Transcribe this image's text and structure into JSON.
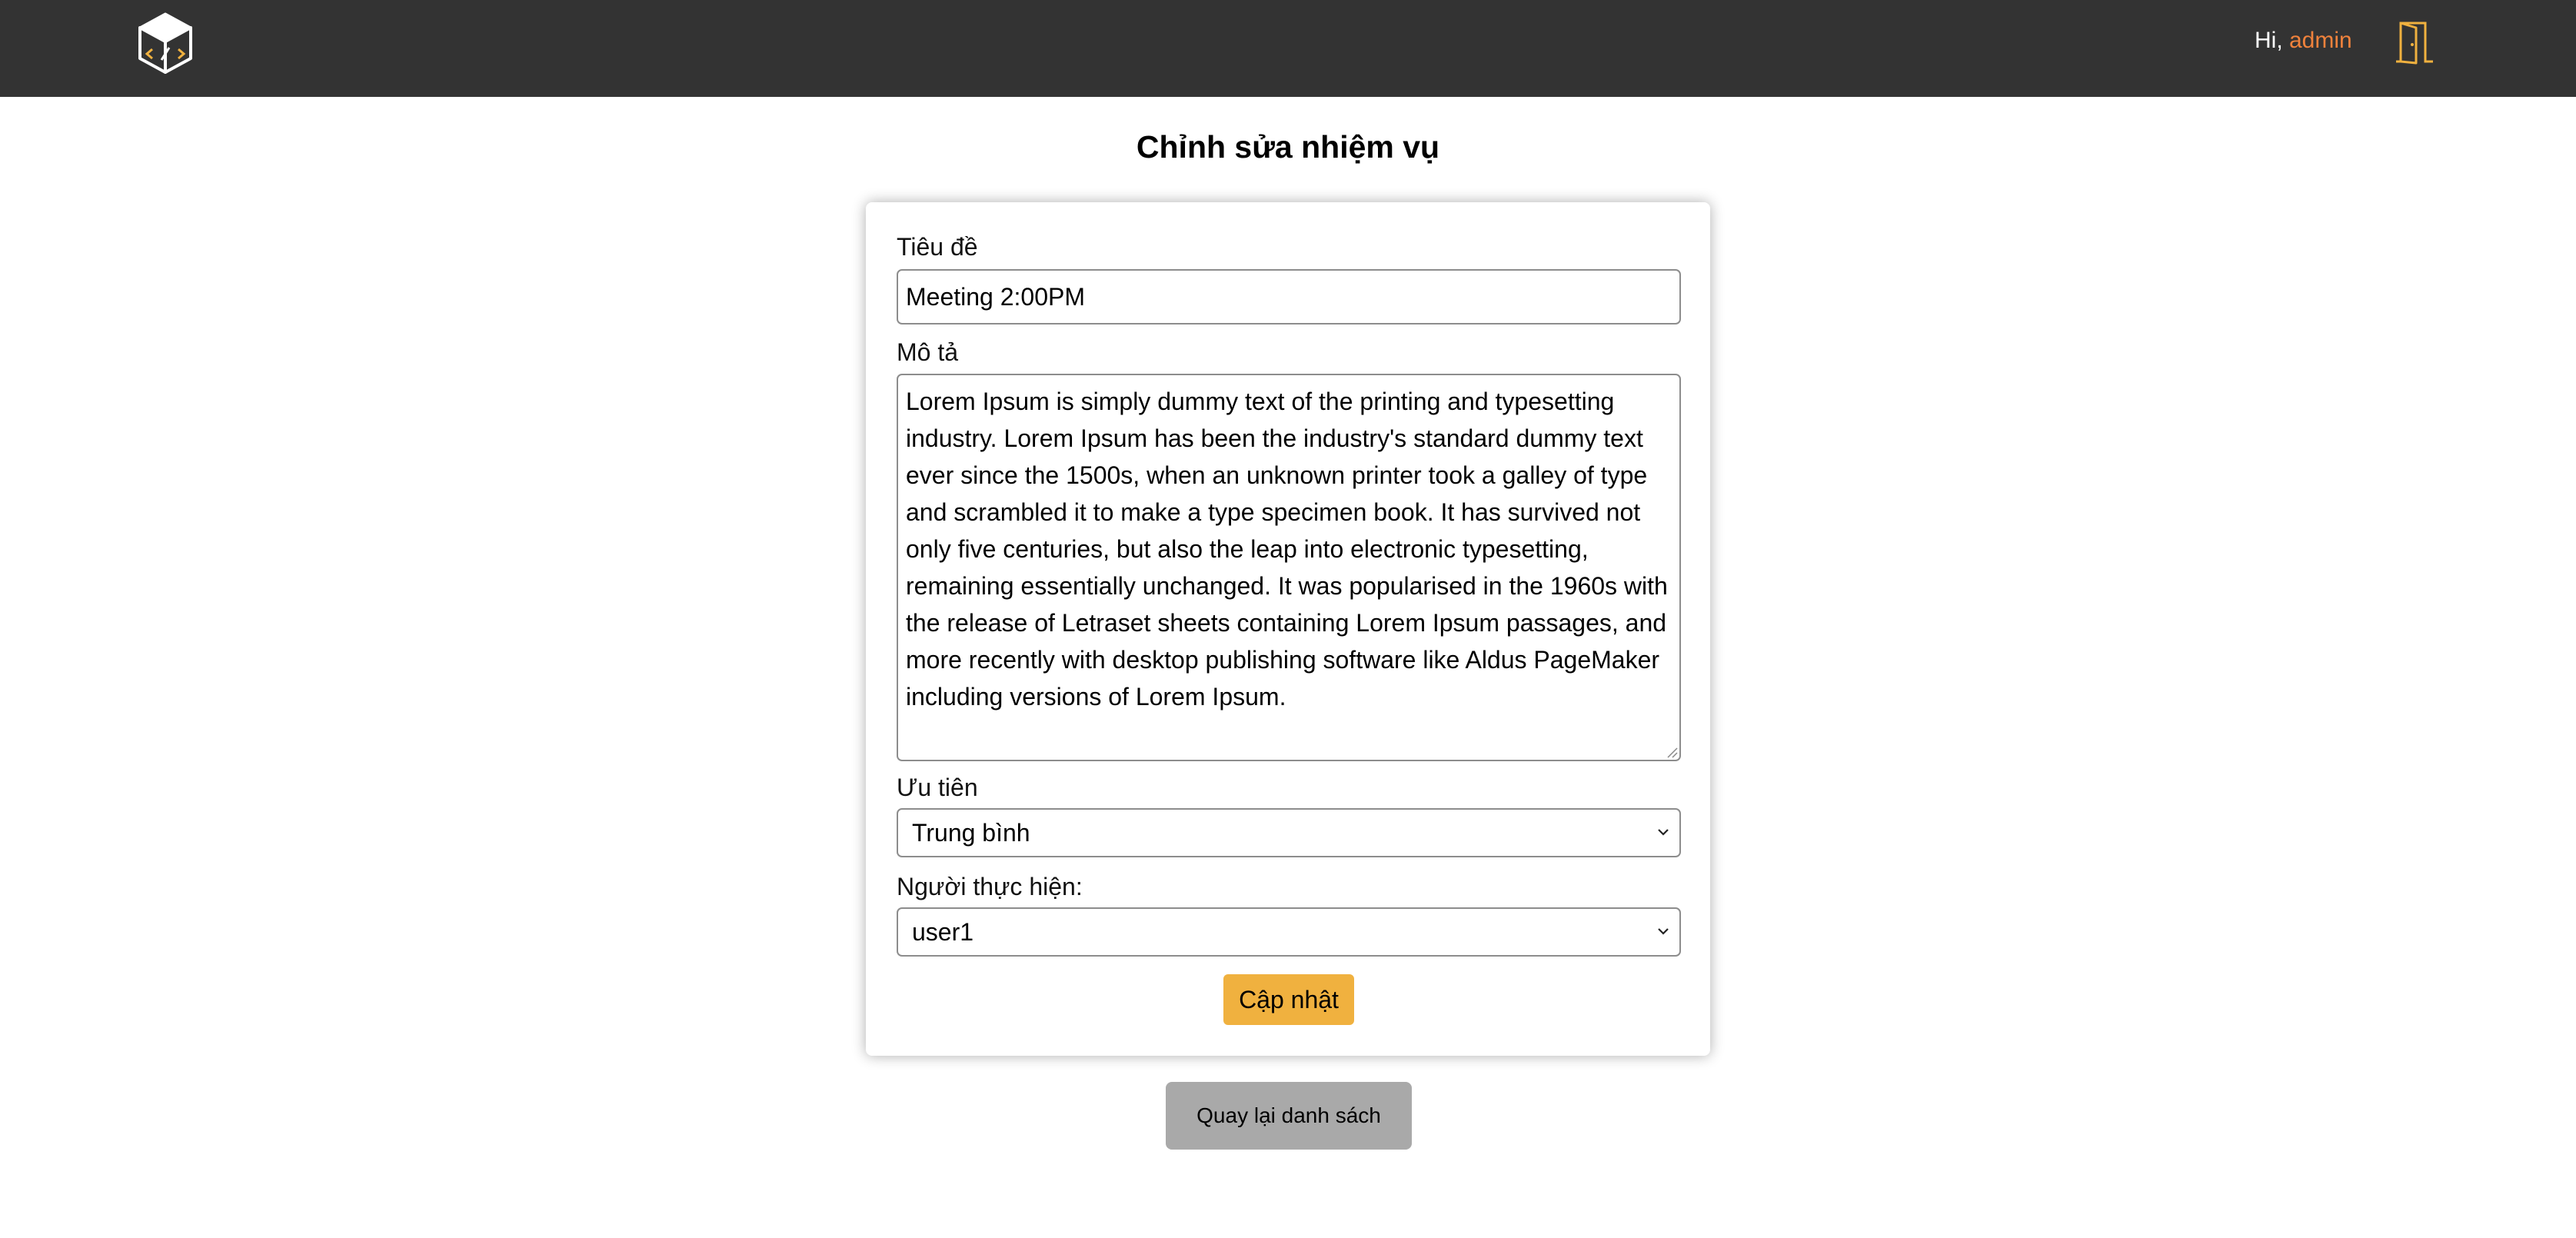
{
  "header": {
    "greeting_prefix": "Hi, ",
    "username": "admin",
    "logo_icon": "logo-cube-icon",
    "logout_icon": "door-icon",
    "accent_color": "#f0823c",
    "door_color": "#f0b13f",
    "background": "#333333"
  },
  "page": {
    "title": "Chỉnh sửa nhiệm vụ"
  },
  "form": {
    "title_label": "Tiêu đề",
    "title_value": "Meeting 2:00PM",
    "description_label": "Mô tả",
    "description_value": "Lorem Ipsum is simply dummy text of the printing and typesetting industry. Lorem Ipsum has been the industry's standard dummy text ever since the 1500s, when an unknown printer took a galley of type and scrambled it to make a type specimen book. It has survived not only five centuries, but also the leap into electronic typesetting, remaining essentially unchanged. It was popularised in the 1960s with the release of Letraset sheets containing Lorem Ipsum passages, and more recently with desktop publishing software like Aldus PageMaker including versions of Lorem Ipsum.",
    "priority_label": "Ưu tiên",
    "priority_value": "Trung bình",
    "assignee_label": "Người thực hiện:",
    "assignee_value": "user1",
    "update_button": "Cập nhật",
    "update_button_color": "#f0b13f"
  },
  "footer": {
    "back_button": "Quay lại danh sách",
    "back_button_color": "#a9a9a9"
  }
}
